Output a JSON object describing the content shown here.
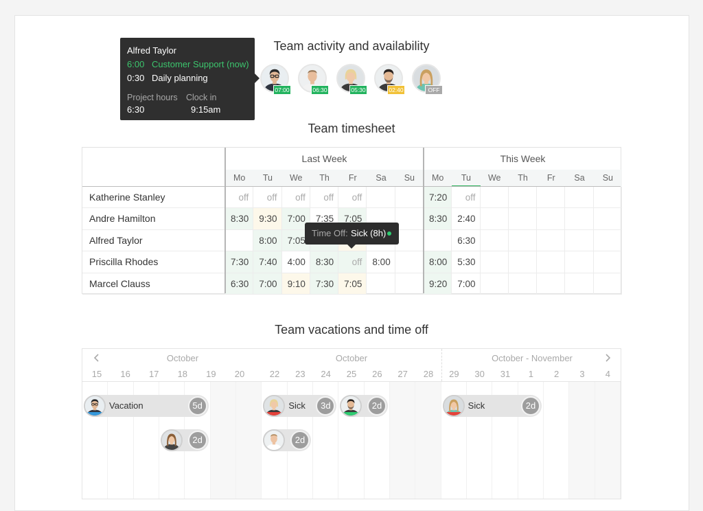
{
  "colors": {
    "badge_active": "#22b35e",
    "badge_warning": "#f1c137",
    "badge_off": "#a9a9a9",
    "cell_green": "#eef7f1",
    "cell_yellow": "#fdf8ea",
    "accent_green": "#2db35d",
    "vacation": "#3498db",
    "sick": "#e5423a",
    "other_leave": "#2ecc71"
  },
  "activity": {
    "title": "Team activity and availability",
    "tooltip": {
      "name": "Alfred Taylor",
      "entries": [
        {
          "time": "6:00",
          "label": "Customer Support (now)",
          "active": true
        },
        {
          "time": "0:30",
          "label": "Daily planning",
          "active": false
        }
      ],
      "stats": [
        {
          "label": "Project hours",
          "value": "6:30"
        },
        {
          "label": "Clock in",
          "value": "9:15am"
        }
      ]
    },
    "members": [
      {
        "badge": "07:00",
        "status": "active"
      },
      {
        "badge": "06:30",
        "status": "active"
      },
      {
        "badge": "05:30",
        "status": "active"
      },
      {
        "badge": "02:40",
        "status": "warning"
      },
      {
        "badge": "OFF",
        "status": "off"
      }
    ]
  },
  "timesheet": {
    "title": "Team timesheet",
    "weeks": [
      {
        "label": "Last Week",
        "days": [
          "Mo",
          "Tu",
          "We",
          "Th",
          "Fr",
          "Sa",
          "Su"
        ],
        "current_day": null
      },
      {
        "label": "This Week",
        "days": [
          "Mo",
          "Tu",
          "We",
          "Th",
          "Fr",
          "Sa",
          "Su"
        ],
        "current_day": 1
      }
    ],
    "rows": [
      {
        "name": "Katherine Stanley",
        "values": [
          "off",
          "off",
          "off",
          "off",
          "off",
          "",
          "",
          "7:20",
          "off",
          "",
          "",
          "",
          "",
          ""
        ],
        "fills": [
          null,
          null,
          null,
          null,
          null,
          null,
          null,
          "g",
          null,
          null,
          null,
          null,
          null,
          null
        ]
      },
      {
        "name": "Andre Hamilton",
        "values": [
          "8:30",
          "9:30",
          "7:00",
          "7:35",
          "7:05",
          "",
          "",
          "8:30",
          "2:40",
          "",
          "",
          "",
          "",
          ""
        ],
        "fills": [
          "g",
          "y",
          "g",
          null,
          "g",
          null,
          null,
          "g",
          null,
          null,
          null,
          null,
          null,
          null
        ]
      },
      {
        "name": "Alfred Taylor",
        "values": [
          "",
          "8:00",
          "7:05",
          "",
          "",
          "",
          "",
          "",
          "6:30",
          "",
          "",
          "",
          "",
          ""
        ],
        "fills": [
          null,
          "g",
          "g",
          "g",
          "y",
          null,
          null,
          null,
          null,
          null,
          null,
          null,
          null,
          null
        ]
      },
      {
        "name": "Priscilla Rhodes",
        "values": [
          "7:30",
          "7:40",
          "4:00",
          "8:30",
          "off",
          "8:00",
          "",
          "8:00",
          "5:30",
          "",
          "",
          "",
          "",
          ""
        ],
        "fills": [
          "g",
          "g",
          null,
          "g",
          "g",
          null,
          null,
          "g",
          null,
          null,
          null,
          null,
          null,
          null
        ]
      },
      {
        "name": "Marcel Clauss",
        "values": [
          "6:30",
          "7:00",
          "9:10",
          "7:30",
          "7:05",
          "",
          "",
          "9:20",
          "7:00",
          "",
          "",
          "",
          "",
          ""
        ],
        "fills": [
          "g",
          "g",
          "y",
          "g",
          "y",
          null,
          null,
          "g",
          null,
          null,
          null,
          null,
          null,
          null
        ]
      }
    ],
    "tooltip": {
      "label": "Time Off:",
      "value": "Sick (8h)"
    }
  },
  "vacations": {
    "title": "Team vacations and time off",
    "sections": [
      {
        "month": "October",
        "days": [
          "15",
          "16",
          "17",
          "18",
          "19",
          "20"
        ]
      },
      {
        "month": "October",
        "days": [
          "22",
          "23",
          "24",
          "25",
          "26",
          "27",
          "28"
        ]
      },
      {
        "month": "October - November",
        "days": [
          "29",
          "30",
          "31",
          "1",
          "2",
          "3",
          "4"
        ]
      }
    ],
    "rows": [
      [
        {
          "label": "Vacation",
          "duration": "5d",
          "section": 0,
          "from": "15",
          "to": "19",
          "type": "vacation"
        },
        {
          "label": "Sick",
          "duration": "3d",
          "section": 1,
          "from": "22",
          "to": "24",
          "type": "sick"
        },
        {
          "label": "",
          "duration": "2d",
          "section": 1,
          "from": "25",
          "to": "26",
          "type": "other_leave"
        },
        {
          "label": "Sick",
          "duration": "2d",
          "section": 2,
          "from": "29",
          "to": "1",
          "type": "sick"
        }
      ],
      [
        {
          "label": "",
          "duration": "2d",
          "section": 0,
          "from": "18",
          "to": "19",
          "type": null
        },
        {
          "label": "",
          "duration": "2d",
          "section": 1,
          "from": "22",
          "to": "23",
          "type": null
        }
      ]
    ]
  }
}
